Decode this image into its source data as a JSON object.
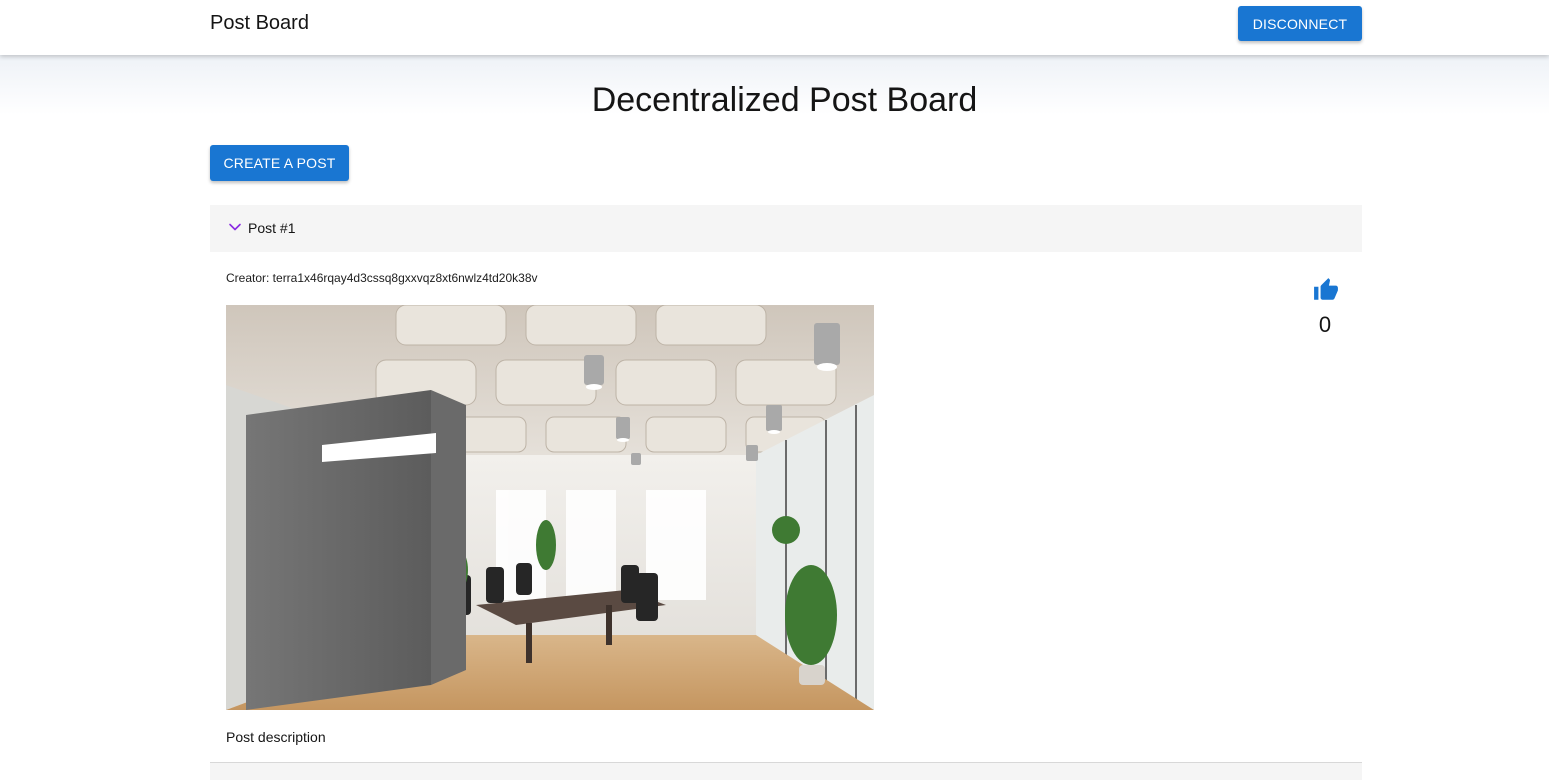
{
  "header": {
    "app_title": "Post Board",
    "disconnect_label": "DISCONNECT"
  },
  "main": {
    "page_title": "Decentralized Post Board",
    "create_post_label": "CREATE A POST"
  },
  "post": {
    "label": "Post #1",
    "creator": "Creator: terra1x46rqay4d3cssq8gxxvqz8xt6nwlz4td20k38v",
    "likes": "0",
    "description": "Post description"
  },
  "colors": {
    "primary": "#1976d2",
    "chevron": "#8a2be2",
    "accordion_bg": "#f5f5f5"
  }
}
